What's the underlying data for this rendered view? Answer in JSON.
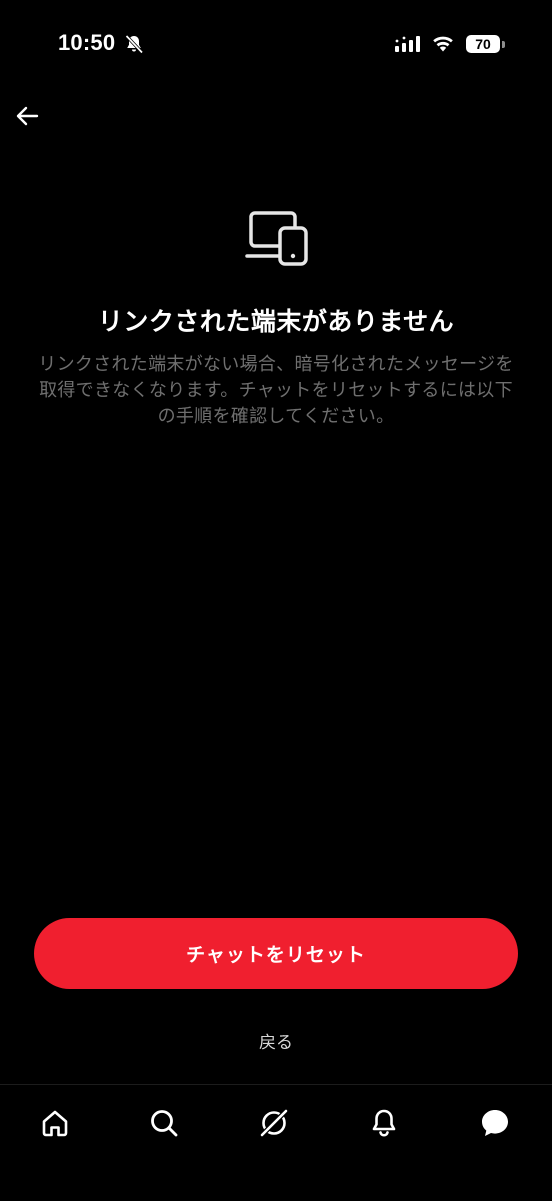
{
  "status_bar": {
    "time": "10:50",
    "battery": "70",
    "icons": [
      "bell-slash-icon",
      "signal-icon",
      "wifi-icon",
      "battery-icon"
    ]
  },
  "header": {
    "back_icon": "arrow-left-icon"
  },
  "empty_state": {
    "icon": "devices-icon",
    "title": "リンクされた端末がありません",
    "description": "リンクされた端末がない場合、暗号化されたメッセージを取得できなくなります。チャットをリセットするには以下の手順を確認してください。"
  },
  "actions": {
    "reset_label": "チャットをリセット",
    "back_label": "戻る"
  },
  "bottom_nav": {
    "items": [
      "home-icon",
      "search-icon",
      "explore-icon",
      "notifications-icon",
      "messages-icon"
    ]
  },
  "colors": {
    "background": "#000000",
    "accent": "#f01f2f",
    "secondary_text": "#6f6f6f"
  }
}
